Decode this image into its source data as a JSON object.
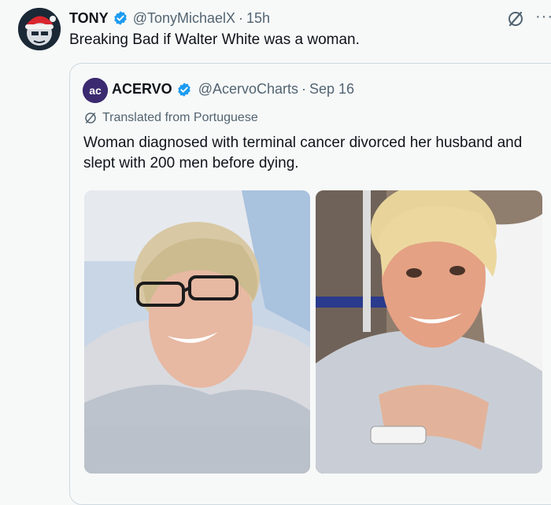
{
  "post": {
    "author_name": "TONY",
    "author_handle": "@TonyMichaelX",
    "separator": "·",
    "time": "15h",
    "text": "Breaking Bad if Walter White was a woman.",
    "more_label": "···"
  },
  "quote": {
    "author_name": "ACERVO",
    "author_handle": "@AcervoCharts",
    "separator": "·",
    "time": "Sep 16",
    "translated_label": "Translated from Portuguese",
    "text": "Woman diagnosed with terminal cancer divorced her husband and slept with 200 men before dying.",
    "avatar_text": "ac"
  },
  "icons": {
    "verified": "verified-badge-icon",
    "grok": "grok-icon",
    "more": "more-icon",
    "translate": "translate-icon"
  },
  "colors": {
    "verified_blue": "#1d9bf0",
    "text": "#0f1419",
    "secondary": "#536471",
    "border": "#cfd9de",
    "background": "#f7f9f9"
  }
}
